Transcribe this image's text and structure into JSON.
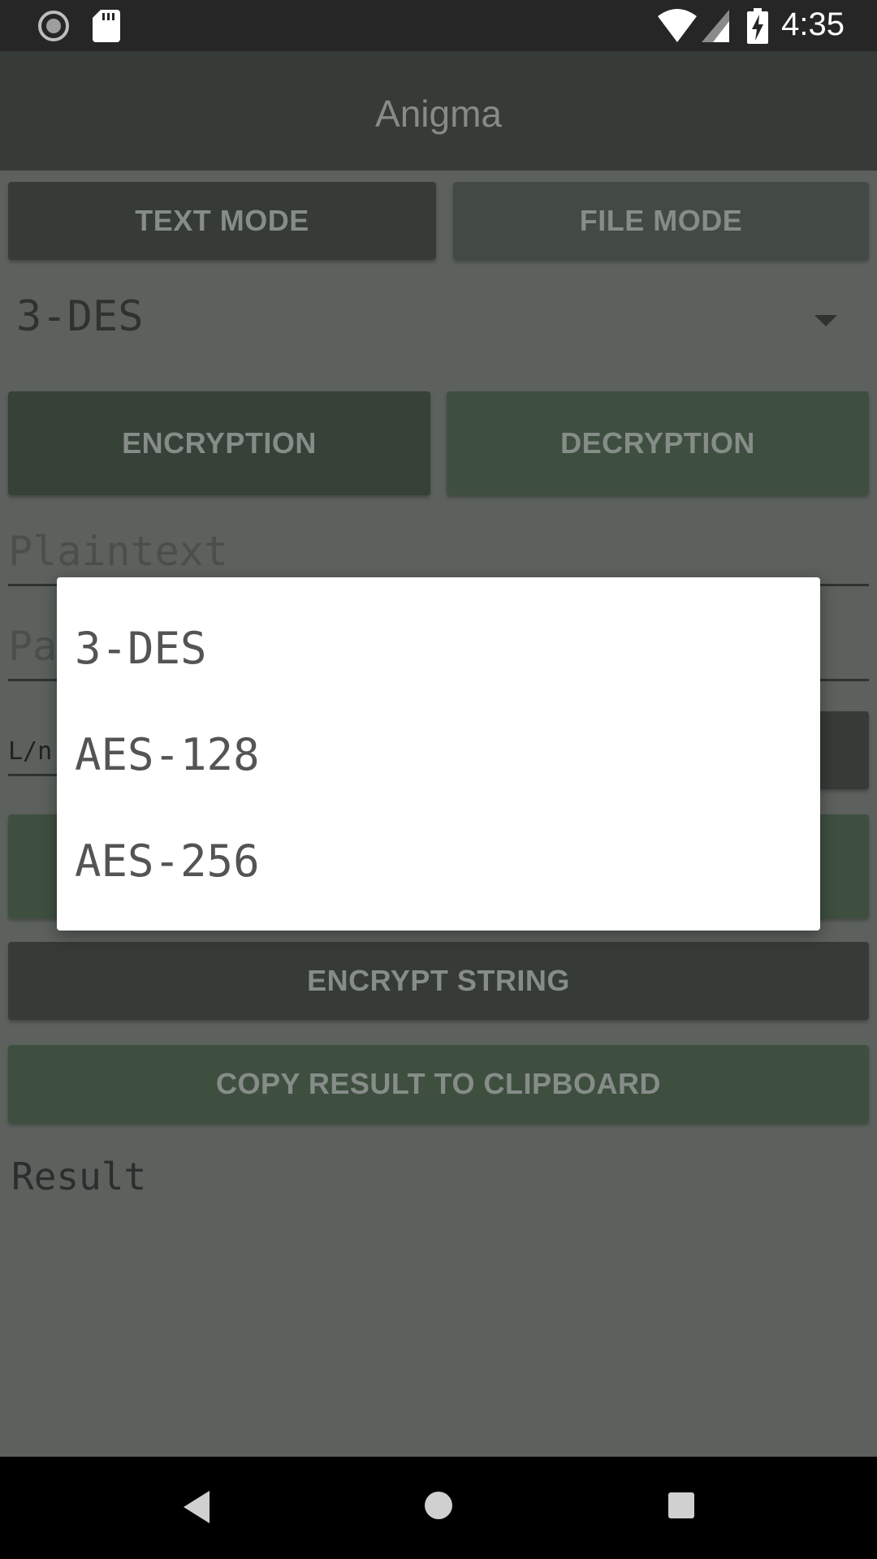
{
  "status_bar": {
    "time": "4:35",
    "icons": [
      "sync-icon",
      "sd-card-icon",
      "wifi-icon",
      "signal-icon",
      "battery-charging-icon"
    ]
  },
  "app_bar": {
    "title": "Anigma"
  },
  "mode_tabs": {
    "text_mode": "TEXT MODE",
    "file_mode": "FILE MODE"
  },
  "algorithm_spinner": {
    "selected": "3-DES"
  },
  "operation_tabs": {
    "encryption": "ENCRYPTION",
    "decryption": "DECRYPTION"
  },
  "fields": {
    "plaintext_placeholder": "Plaintext",
    "password_placeholder_partial": "Pa",
    "length_label_partial": "L/n"
  },
  "actions": {
    "encrypt_string": "ENCRYPT STRING",
    "copy_result": "COPY RESULT TO CLIPBOARD"
  },
  "result": {
    "label": "Result"
  },
  "dropdown": {
    "options": [
      "3-DES",
      "AES-128",
      "AES-256"
    ]
  }
}
